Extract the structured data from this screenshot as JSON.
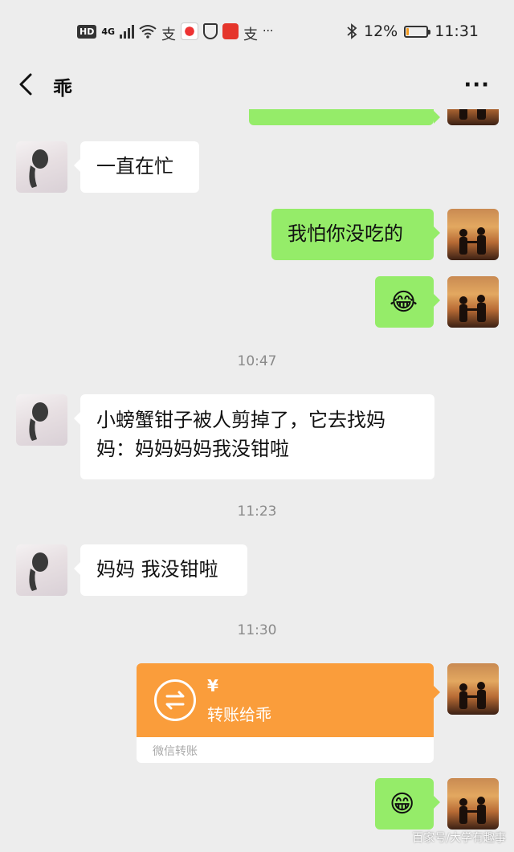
{
  "status_bar": {
    "hd": "HD",
    "network": "4G",
    "battery": "12%",
    "battery_fraction": 0.12,
    "time": "11:31",
    "more": "···"
  },
  "nav": {
    "title": "乖",
    "more": "···"
  },
  "messages": {
    "m1": "一直在忙",
    "m2": "我怕你没吃的",
    "m3_emoji": "😂",
    "t1": "10:47",
    "m4": "小螃蟹钳子被人剪掉了，它去找妈妈：妈妈妈妈我没钳啦",
    "t2": "11:23",
    "m5": "妈妈 我没钳啦",
    "t3": "11:30",
    "transfer": {
      "amount": "¥",
      "label": "转账给乖",
      "caption": "微信转账"
    },
    "m7_emoji": "😁"
  },
  "watermark": "百家号/大学有趣事",
  "colors": {
    "background": "#ededed",
    "outgoing_bubble": "#95ec69",
    "incoming_bubble": "#ffffff",
    "transfer": "#fa9d3b"
  }
}
